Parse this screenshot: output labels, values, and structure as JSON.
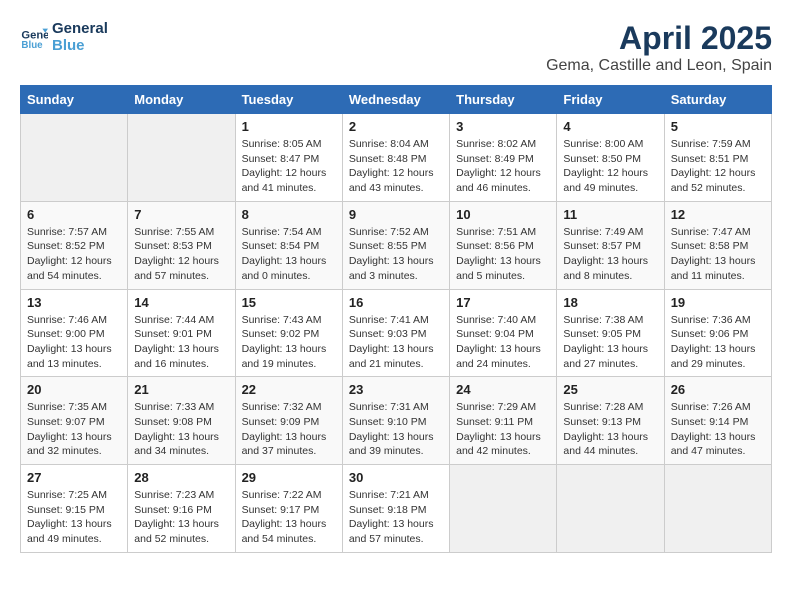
{
  "header": {
    "logo_line1": "General",
    "logo_line2": "Blue",
    "title": "April 2025",
    "subtitle": "Gema, Castille and Leon, Spain"
  },
  "columns": [
    "Sunday",
    "Monday",
    "Tuesday",
    "Wednesday",
    "Thursday",
    "Friday",
    "Saturday"
  ],
  "weeks": [
    [
      {
        "day": "",
        "empty": true
      },
      {
        "day": "",
        "empty": true
      },
      {
        "day": "1",
        "sunrise": "Sunrise: 8:05 AM",
        "sunset": "Sunset: 8:47 PM",
        "daylight": "Daylight: 12 hours and 41 minutes."
      },
      {
        "day": "2",
        "sunrise": "Sunrise: 8:04 AM",
        "sunset": "Sunset: 8:48 PM",
        "daylight": "Daylight: 12 hours and 43 minutes."
      },
      {
        "day": "3",
        "sunrise": "Sunrise: 8:02 AM",
        "sunset": "Sunset: 8:49 PM",
        "daylight": "Daylight: 12 hours and 46 minutes."
      },
      {
        "day": "4",
        "sunrise": "Sunrise: 8:00 AM",
        "sunset": "Sunset: 8:50 PM",
        "daylight": "Daylight: 12 hours and 49 minutes."
      },
      {
        "day": "5",
        "sunrise": "Sunrise: 7:59 AM",
        "sunset": "Sunset: 8:51 PM",
        "daylight": "Daylight: 12 hours and 52 minutes."
      }
    ],
    [
      {
        "day": "6",
        "sunrise": "Sunrise: 7:57 AM",
        "sunset": "Sunset: 8:52 PM",
        "daylight": "Daylight: 12 hours and 54 minutes."
      },
      {
        "day": "7",
        "sunrise": "Sunrise: 7:55 AM",
        "sunset": "Sunset: 8:53 PM",
        "daylight": "Daylight: 12 hours and 57 minutes."
      },
      {
        "day": "8",
        "sunrise": "Sunrise: 7:54 AM",
        "sunset": "Sunset: 8:54 PM",
        "daylight": "Daylight: 13 hours and 0 minutes."
      },
      {
        "day": "9",
        "sunrise": "Sunrise: 7:52 AM",
        "sunset": "Sunset: 8:55 PM",
        "daylight": "Daylight: 13 hours and 3 minutes."
      },
      {
        "day": "10",
        "sunrise": "Sunrise: 7:51 AM",
        "sunset": "Sunset: 8:56 PM",
        "daylight": "Daylight: 13 hours and 5 minutes."
      },
      {
        "day": "11",
        "sunrise": "Sunrise: 7:49 AM",
        "sunset": "Sunset: 8:57 PM",
        "daylight": "Daylight: 13 hours and 8 minutes."
      },
      {
        "day": "12",
        "sunrise": "Sunrise: 7:47 AM",
        "sunset": "Sunset: 8:58 PM",
        "daylight": "Daylight: 13 hours and 11 minutes."
      }
    ],
    [
      {
        "day": "13",
        "sunrise": "Sunrise: 7:46 AM",
        "sunset": "Sunset: 9:00 PM",
        "daylight": "Daylight: 13 hours and 13 minutes."
      },
      {
        "day": "14",
        "sunrise": "Sunrise: 7:44 AM",
        "sunset": "Sunset: 9:01 PM",
        "daylight": "Daylight: 13 hours and 16 minutes."
      },
      {
        "day": "15",
        "sunrise": "Sunrise: 7:43 AM",
        "sunset": "Sunset: 9:02 PM",
        "daylight": "Daylight: 13 hours and 19 minutes."
      },
      {
        "day": "16",
        "sunrise": "Sunrise: 7:41 AM",
        "sunset": "Sunset: 9:03 PM",
        "daylight": "Daylight: 13 hours and 21 minutes."
      },
      {
        "day": "17",
        "sunrise": "Sunrise: 7:40 AM",
        "sunset": "Sunset: 9:04 PM",
        "daylight": "Daylight: 13 hours and 24 minutes."
      },
      {
        "day": "18",
        "sunrise": "Sunrise: 7:38 AM",
        "sunset": "Sunset: 9:05 PM",
        "daylight": "Daylight: 13 hours and 27 minutes."
      },
      {
        "day": "19",
        "sunrise": "Sunrise: 7:36 AM",
        "sunset": "Sunset: 9:06 PM",
        "daylight": "Daylight: 13 hours and 29 minutes."
      }
    ],
    [
      {
        "day": "20",
        "sunrise": "Sunrise: 7:35 AM",
        "sunset": "Sunset: 9:07 PM",
        "daylight": "Daylight: 13 hours and 32 minutes."
      },
      {
        "day": "21",
        "sunrise": "Sunrise: 7:33 AM",
        "sunset": "Sunset: 9:08 PM",
        "daylight": "Daylight: 13 hours and 34 minutes."
      },
      {
        "day": "22",
        "sunrise": "Sunrise: 7:32 AM",
        "sunset": "Sunset: 9:09 PM",
        "daylight": "Daylight: 13 hours and 37 minutes."
      },
      {
        "day": "23",
        "sunrise": "Sunrise: 7:31 AM",
        "sunset": "Sunset: 9:10 PM",
        "daylight": "Daylight: 13 hours and 39 minutes."
      },
      {
        "day": "24",
        "sunrise": "Sunrise: 7:29 AM",
        "sunset": "Sunset: 9:11 PM",
        "daylight": "Daylight: 13 hours and 42 minutes."
      },
      {
        "day": "25",
        "sunrise": "Sunrise: 7:28 AM",
        "sunset": "Sunset: 9:13 PM",
        "daylight": "Daylight: 13 hours and 44 minutes."
      },
      {
        "day": "26",
        "sunrise": "Sunrise: 7:26 AM",
        "sunset": "Sunset: 9:14 PM",
        "daylight": "Daylight: 13 hours and 47 minutes."
      }
    ],
    [
      {
        "day": "27",
        "sunrise": "Sunrise: 7:25 AM",
        "sunset": "Sunset: 9:15 PM",
        "daylight": "Daylight: 13 hours and 49 minutes."
      },
      {
        "day": "28",
        "sunrise": "Sunrise: 7:23 AM",
        "sunset": "Sunset: 9:16 PM",
        "daylight": "Daylight: 13 hours and 52 minutes."
      },
      {
        "day": "29",
        "sunrise": "Sunrise: 7:22 AM",
        "sunset": "Sunset: 9:17 PM",
        "daylight": "Daylight: 13 hours and 54 minutes."
      },
      {
        "day": "30",
        "sunrise": "Sunrise: 7:21 AM",
        "sunset": "Sunset: 9:18 PM",
        "daylight": "Daylight: 13 hours and 57 minutes."
      },
      {
        "day": "",
        "empty": true
      },
      {
        "day": "",
        "empty": true
      },
      {
        "day": "",
        "empty": true
      }
    ]
  ]
}
